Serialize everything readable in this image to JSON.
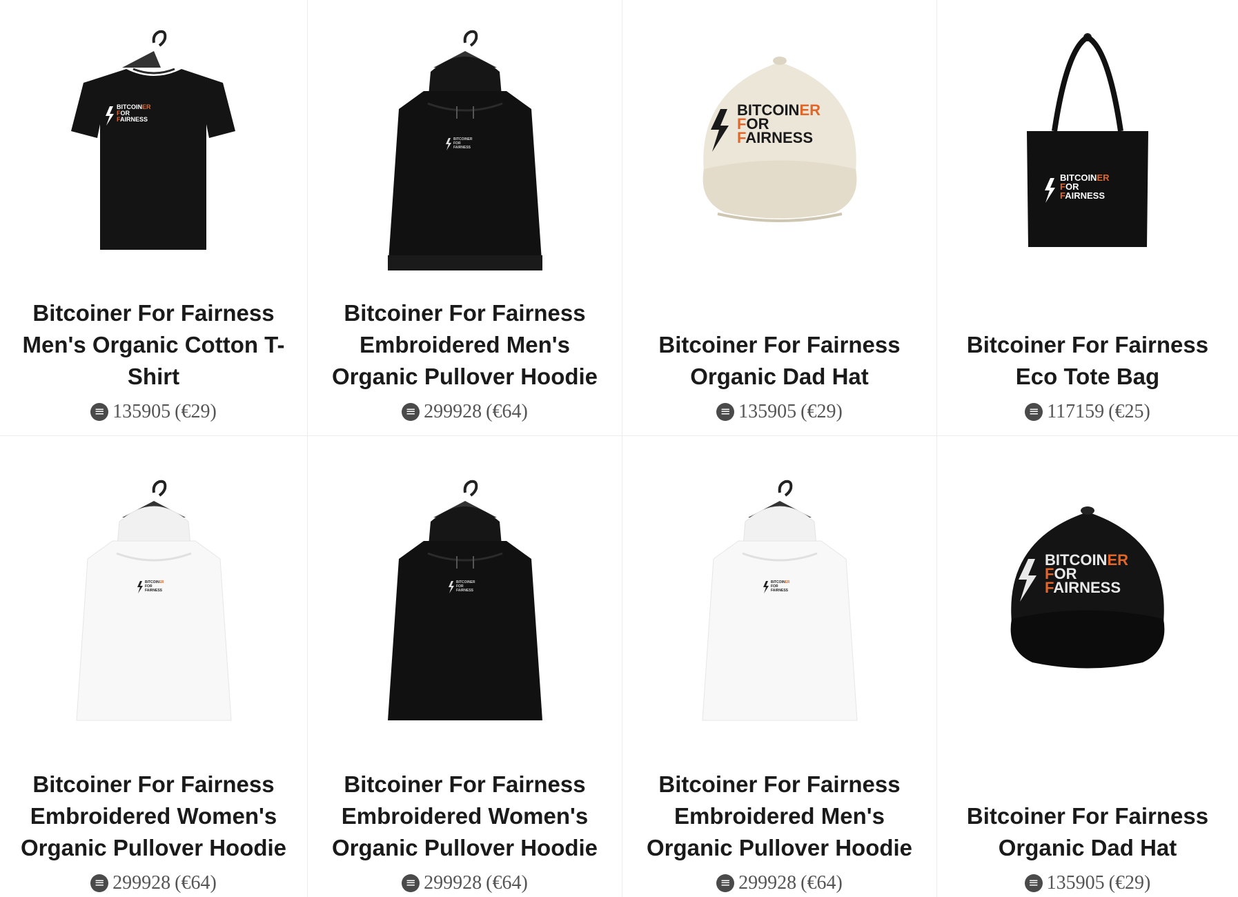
{
  "products": [
    {
      "title": "Bitcoiner For Fairness Men's Organic Cotton T-Shirt",
      "price_sats": "135905",
      "price_eur": "(€29)",
      "image": "tshirt-black"
    },
    {
      "title": "Bitcoiner For Fairness Embroidered Men's Organic Pullover Hoodie",
      "price_sats": "299928",
      "price_eur": "(€64)",
      "image": "hoodie-black"
    },
    {
      "title": "Bitcoiner For Fairness Organic Dad Hat",
      "price_sats": "135905",
      "price_eur": "(€29)",
      "image": "cap-beige"
    },
    {
      "title": "Bitcoiner For Fairness Eco Tote Bag",
      "price_sats": "117159",
      "price_eur": "(€25)",
      "image": "tote-black"
    },
    {
      "title": "Bitcoiner For Fairness Embroidered Women's Organic Pullover Hoodie",
      "price_sats": "299928",
      "price_eur": "(€64)",
      "image": "hoodie-white"
    },
    {
      "title": "Bitcoiner For Fairness Embroidered Women's Organic Pullover Hoodie",
      "price_sats": "299928",
      "price_eur": "(€64)",
      "image": "hoodie-black"
    },
    {
      "title": "Bitcoiner For Fairness Embroidered Men's Organic Pullover Hoodie",
      "price_sats": "299928",
      "price_eur": "(€64)",
      "image": "hoodie-white"
    },
    {
      "title": "Bitcoiner For Fairness Organic Dad Hat",
      "price_sats": "135905",
      "price_eur": "(€29)",
      "image": "cap-black"
    }
  ],
  "logo": {
    "line1a": "BITCOIN",
    "line1b": "ER",
    "line2a": "F",
    "line2b": "OR",
    "line3a": "F",
    "line3b": "AIRNESS"
  },
  "currency_icon": "satoshi-coin-icon",
  "colors": {
    "accent": "#e0662a",
    "text": "#1a1a1a",
    "price": "#555555"
  }
}
